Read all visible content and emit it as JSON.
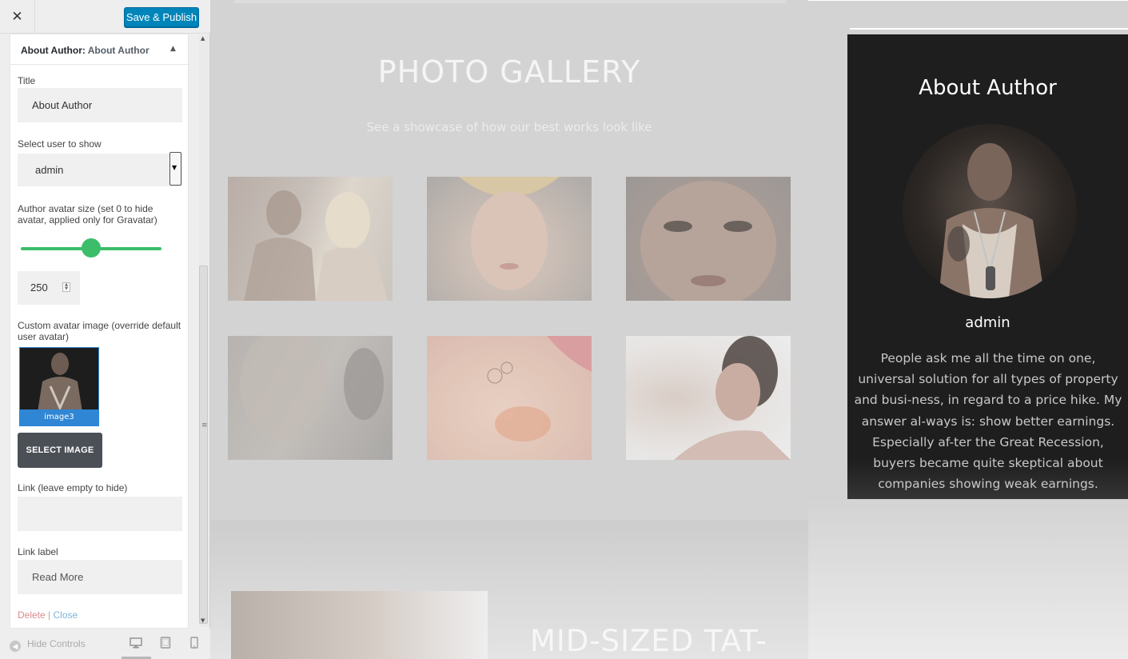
{
  "header": {
    "close_icon": "close-icon",
    "save_label": "Save & Publish"
  },
  "panel": {
    "title_main": "About Author:",
    "title_sub": "About Author",
    "fields": {
      "title_label": "Title",
      "title_value": "About Author",
      "user_label": "Select user to show",
      "user_value": "admin",
      "avatar_size_label": "Author avatar size (set 0 to hide avatar, applied only for Gravatar)",
      "avatar_size_value": "250",
      "avatar_slider_fraction": 0.5,
      "custom_avatar_label": "Custom avatar image (override default user avatar)",
      "custom_avatar_caption": "image3",
      "select_image_label": "SELECT IMAGE",
      "link_label": "Link (leave empty to hide)",
      "link_value": "",
      "link_label_label": "Link label",
      "link_label_value": "Read More"
    },
    "delete_label": "Delete",
    "separator": "|",
    "close_label": "Close"
  },
  "footer": {
    "hide_controls_label": "Hide Controls"
  },
  "preview": {
    "gallery_title": "PHOTO GALLERY",
    "gallery_subtitle": "See a showcase of how our best works look like",
    "section_heading": "MID-SIZED TAT-",
    "author": {
      "heading": "About Author",
      "name": "admin",
      "bio": "People ask me all the time on one, universal solution for all types of property and busi-ness, in regard to a price hike. My answer al-ways is: show better earnings. Especially af-ter the Great Recession, buyers became quite skeptical about companies showing weak earnings."
    }
  },
  "colors": {
    "primary_button": "#0085ba",
    "slider": "#3cbd6a",
    "select_image_button": "#4b4f56",
    "author_box": "#1e1e1e"
  }
}
